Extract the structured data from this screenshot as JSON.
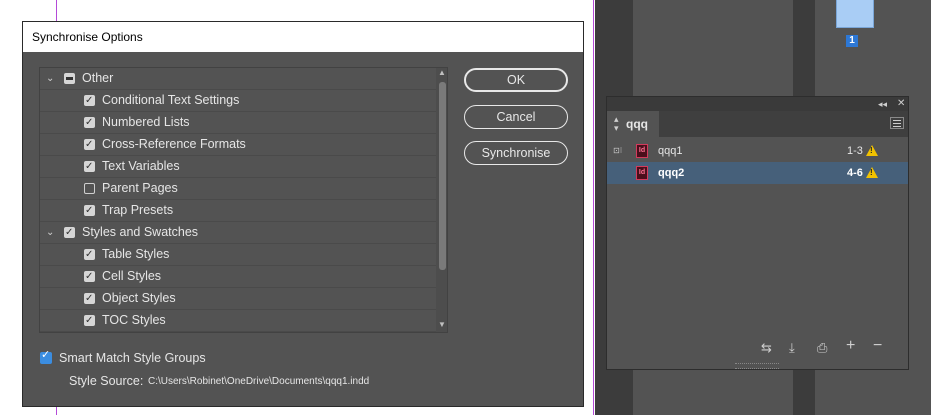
{
  "pages_panel": {
    "page_number": "1"
  },
  "dialog": {
    "title": "Synchronise Options",
    "items": [
      {
        "label": "Other",
        "level": 0,
        "expanded": true,
        "state": "mixed"
      },
      {
        "label": "Conditional Text Settings",
        "level": 1,
        "state": "on"
      },
      {
        "label": "Numbered Lists",
        "level": 1,
        "state": "on"
      },
      {
        "label": "Cross-Reference Formats",
        "level": 1,
        "state": "on"
      },
      {
        "label": "Text Variables",
        "level": 1,
        "state": "on"
      },
      {
        "label": "Parent Pages",
        "level": 1,
        "state": "off"
      },
      {
        "label": "Trap Presets",
        "level": 1,
        "state": "on"
      },
      {
        "label": "Styles and Swatches",
        "level": 0,
        "expanded": true,
        "state": "on"
      },
      {
        "label": "Table Styles",
        "level": 1,
        "state": "on"
      },
      {
        "label": "Cell Styles",
        "level": 1,
        "state": "on"
      },
      {
        "label": "Object Styles",
        "level": 1,
        "state": "on"
      },
      {
        "label": "TOC Styles",
        "level": 1,
        "state": "on"
      }
    ],
    "buttons": {
      "ok": "OK",
      "cancel": "Cancel",
      "synchronise": "Synchronise"
    },
    "smart_match_label": "Smart Match Style Groups",
    "smart_match_checked": true,
    "style_source_label": "Style Source:",
    "style_source_path": "C:\\Users\\Robinet\\OneDrive\\Documents\\qqq1.indd"
  },
  "book_panel": {
    "tab_label": "qqq",
    "documents": [
      {
        "name": "qqq1",
        "pages": "1-3",
        "selected": false,
        "style_source": true
      },
      {
        "name": "qqq2",
        "pages": "4-6",
        "selected": true,
        "style_source": false
      }
    ],
    "doc_icon_text": "Id",
    "footer_icons": [
      "synchronise-icon",
      "save-book-icon",
      "print-book-icon",
      "add-document-icon",
      "remove-document-icon"
    ]
  },
  "colors": {
    "accent": "#3b8de0",
    "selection": "#46607a",
    "warning": "#f2c200",
    "id_icon": "#d33a5c"
  }
}
